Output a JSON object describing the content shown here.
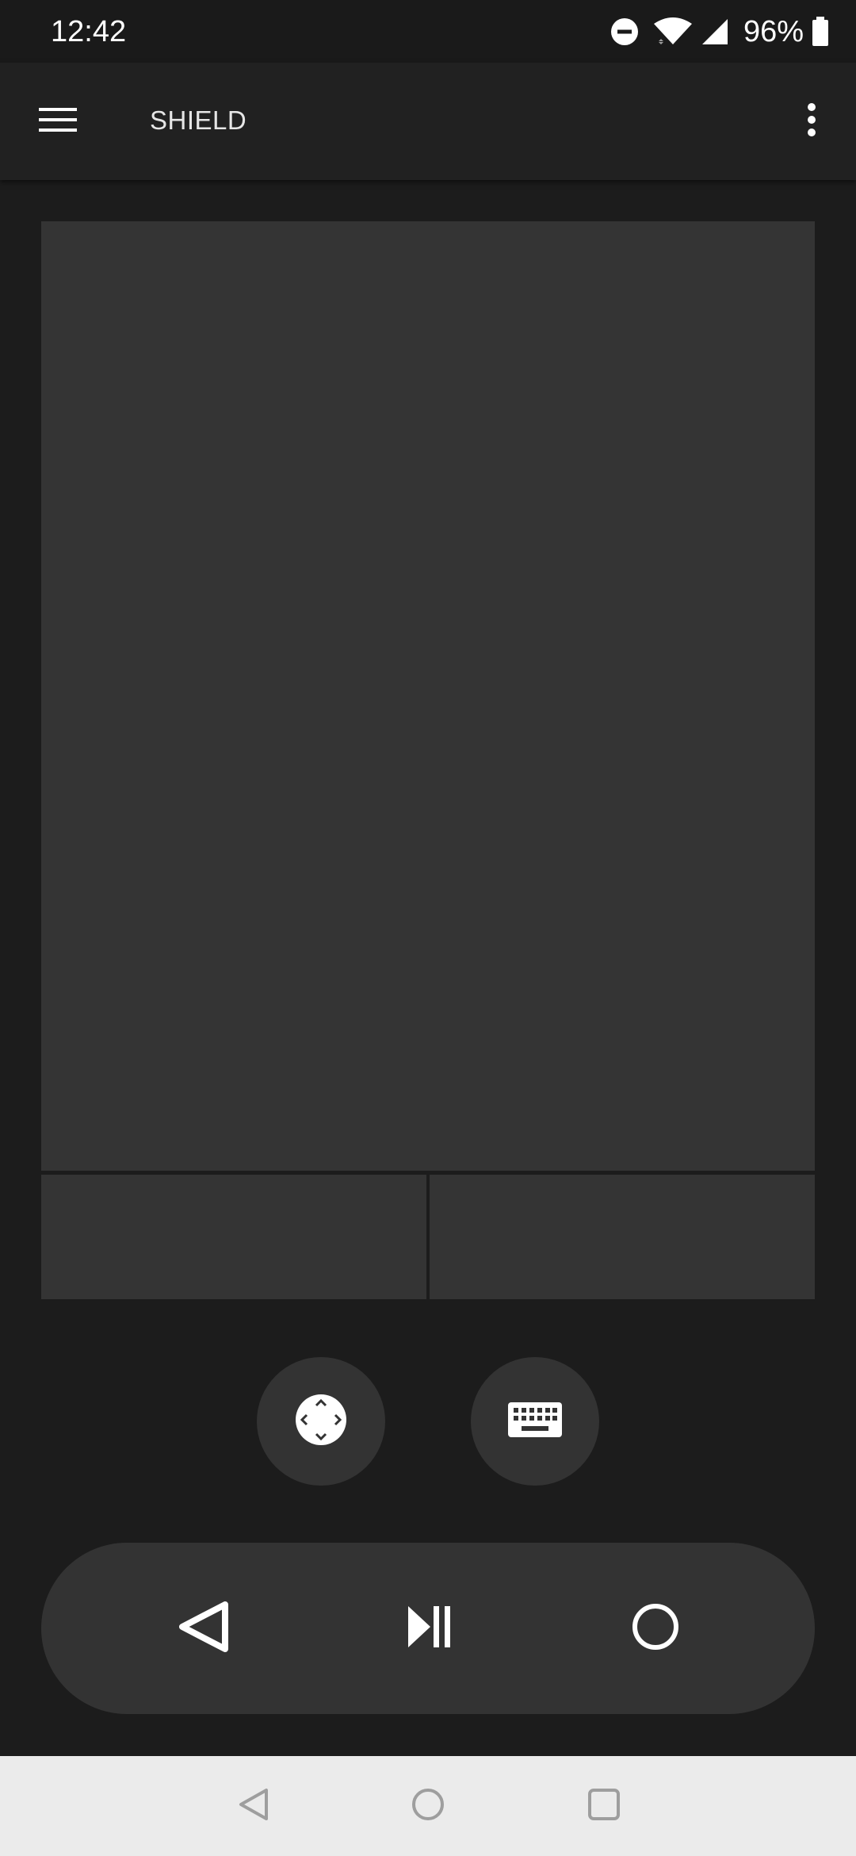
{
  "status_bar": {
    "time": "12:42",
    "battery_percent": "96%",
    "icons": [
      "do-not-disturb-icon",
      "wifi-icon",
      "cell-signal-icon",
      "battery-icon"
    ]
  },
  "app_bar": {
    "title": "SHIELD",
    "menu_icon": "hamburger-menu-icon",
    "overflow_icon": "more-vert-icon"
  },
  "controls": {
    "touchpad": "touchpad",
    "dpad_icon": "dpad-icon",
    "keyboard_icon": "keyboard-icon"
  },
  "media_bar": {
    "buttons": [
      "back-triangle-icon",
      "play-pause-icon",
      "home-circle-icon"
    ]
  },
  "system_nav": {
    "buttons": [
      "nav-back-icon",
      "nav-home-icon",
      "nav-recents-icon"
    ]
  },
  "colors": {
    "background": "#1c1c1c",
    "app_bar": "#212121",
    "surface": "#343434",
    "button": "#333333",
    "icon": "#ffffff",
    "nav_bar": "#ebebeb",
    "nav_icon": "#9e9e9e"
  }
}
